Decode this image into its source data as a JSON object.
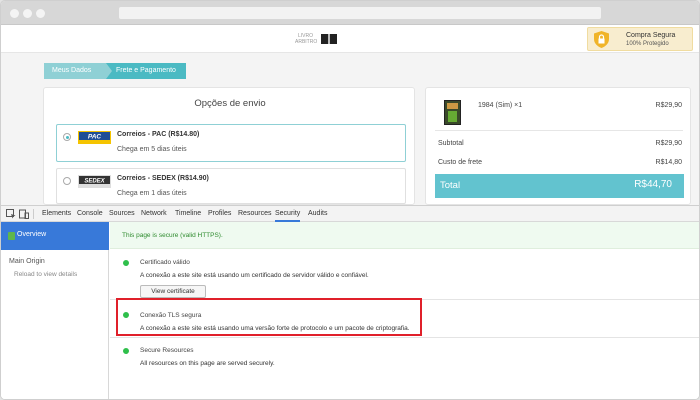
{
  "site": {
    "logo_line1": "LIVRO",
    "logo_line2": "ARBITRO",
    "badge_title": "Compra Segura",
    "badge_sub": "100% Protegido"
  },
  "steps": [
    "Meus Dados",
    "Frete e Pagamento"
  ],
  "shipping": {
    "title": "Opções de envio",
    "options": [
      {
        "carrier": "PAC",
        "name": "Correios - PAC (R$14.80)",
        "eta": "Chega em 5 dias úteis",
        "selected": true
      },
      {
        "carrier": "SEDEX",
        "name": "Correios - SEDEX (R$14.90)",
        "eta": "Chega em 1 dias úteis",
        "selected": false
      }
    ]
  },
  "cart": {
    "item_name": "1984 (Sim) ×1",
    "item_price": "R$29,90",
    "subtotal_label": "Subtotal",
    "subtotal_value": "R$29,90",
    "freight_label": "Custo de frete",
    "freight_value": "R$14,80",
    "total_label": "Total",
    "total_value": "R$44,70"
  },
  "devtools": {
    "tabs": [
      "Elements",
      "Console",
      "Sources",
      "Network",
      "Timeline",
      "Profiles",
      "Resources",
      "Security",
      "Audits"
    ],
    "active_tab": "Security",
    "sidebar": {
      "overview": "Overview",
      "main_origin": "Main Origin",
      "reload": "Reload to view details"
    },
    "secure_message": "This page is secure (valid HTTPS).",
    "sections": [
      {
        "title": "Certificado válido",
        "desc": "A conexão a este site está usando um certificado de servidor válido e confiável.",
        "button": "View certificate"
      },
      {
        "title": "Conexão TLS segura",
        "desc": "A conexão a este site está usando uma versão forte de protocolo e um pacote de criptografia."
      },
      {
        "title": "Secure Resources",
        "desc": "All resources on this page are served securely."
      }
    ]
  },
  "colors": {
    "teal": "#4bbac3",
    "devtools_blue": "#3879d9",
    "secure_green": "#2fbf4b",
    "highlight_red": "#e0202a"
  }
}
